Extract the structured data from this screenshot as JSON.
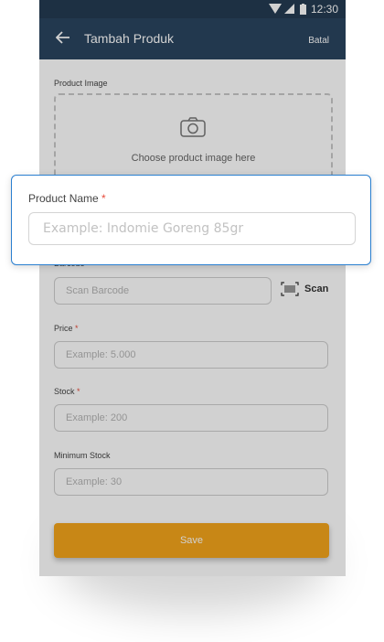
{
  "statusbar": {
    "time": "12:30"
  },
  "appbar": {
    "title": "Tambah Produk",
    "action": "Batal"
  },
  "form": {
    "image_label": "Product Image",
    "image_hint": "Choose product image here",
    "barcode_label": "Barcode",
    "barcode_placeholder": "Scan Barcode",
    "scan_label": "Scan",
    "price_label": "Price",
    "price_placeholder": "Example: 5.000",
    "stock_label": "Stock",
    "stock_placeholder": "Example: 200",
    "minstock_label": "Minimum Stock",
    "minstock_placeholder": "Example: 30",
    "required_mark": "*",
    "save_label": "Save"
  },
  "focus_card": {
    "label": "Product Name",
    "required_mark": "*",
    "placeholder": "Example: Indomie Goreng 85gr"
  },
  "colors": {
    "appbar": "#2a4560",
    "accent": "#f5a51c",
    "focus_border": "#2a7fd0",
    "required": "#e74c3c"
  }
}
